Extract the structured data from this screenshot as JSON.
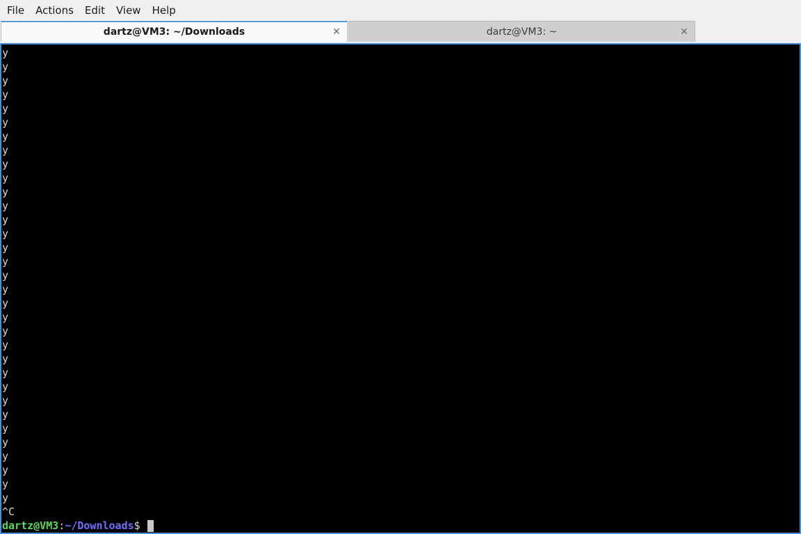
{
  "menu": {
    "items": [
      "File",
      "Actions",
      "Edit",
      "View",
      "Help"
    ]
  },
  "tabs": [
    {
      "title": "dartz@VM3: ~/Downloads",
      "active": true,
      "close_icon": "close-icon"
    },
    {
      "title": "dartz@VM3: ~",
      "active": false,
      "close_icon": "close-icon"
    }
  ],
  "terminal": {
    "output_lines": [
      "y",
      "y",
      "y",
      "y",
      "y",
      "y",
      "y",
      "y",
      "y",
      "y",
      "y",
      "y",
      "y",
      "y",
      "y",
      "y",
      "y",
      "y",
      "y",
      "y",
      "y",
      "y",
      "y",
      "y",
      "y",
      "y",
      "y",
      "y",
      "y",
      "y",
      "y",
      "y",
      "y",
      "^C"
    ],
    "prompt": {
      "user_host": "dartz@VM3",
      "separator": ":",
      "path": "~/Downloads",
      "symbol": "$ "
    },
    "colors": {
      "background": "#000000",
      "user_host": "#5ad85a",
      "path": "#6f6fff",
      "text": "#d8d8d8"
    }
  }
}
